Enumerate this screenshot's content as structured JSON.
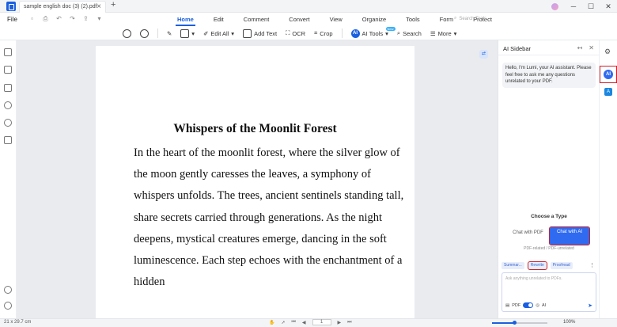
{
  "titlebar": {
    "tab_title": "sample english doc (3) (2).pdf",
    "tab_close": "×",
    "new_tab": "+"
  },
  "menu": {
    "file": "File",
    "items": [
      "Home",
      "Edit",
      "Comment",
      "Convert",
      "View",
      "Organize",
      "Tools",
      "Form",
      "Protect"
    ],
    "active": "Home",
    "search_tools_placeholder": "Search Tools"
  },
  "toolbar": {
    "edit_all": "Edit All",
    "add_text": "Add Text",
    "ocr": "OCR",
    "crop": "Crop",
    "ai_tools": "AI Tools",
    "ai_tools_badge": "New",
    "search": "Search",
    "more": "More"
  },
  "document": {
    "title": "Whispers of the Moonlit Forest",
    "body": "In the heart of the moonlit forest, where the silver glow of the moon gently caresses the leaves, a symphony of whispers unfolds. The trees, ancient sentinels standing tall, share secrets carried through generations. As the night deepens, mystical creatures emerge, dancing in the soft luminescence. Each step echoes with the enchantment of a hidden"
  },
  "statusbar": {
    "page_size": "21 x 29.7 cm",
    "page_number": "1",
    "zoom": "100%",
    "zoom_fraction": 0.4
  },
  "ai_sidebar": {
    "title": "AI Sidebar",
    "greeting": "Hello, I'm Lumi, your AI assistant. Please feel free to ask me any questions unrelated to your PDF.",
    "choose_type": "Choose a Type",
    "chat_with_pdf": "Chat with PDF",
    "chat_with_ai": "Chat with AI",
    "pdf_related_note": "PDF-related / PDF-unrelated",
    "actions": [
      "Summar...",
      "Rewrite",
      "Proofread"
    ],
    "input_placeholder": "Ask anything unrelated to PDFs.",
    "pdf_label": "PDF",
    "ai_label": "AI"
  },
  "colors": {
    "accent": "#1a5fe0",
    "highlight_outline": "#d0202a"
  }
}
